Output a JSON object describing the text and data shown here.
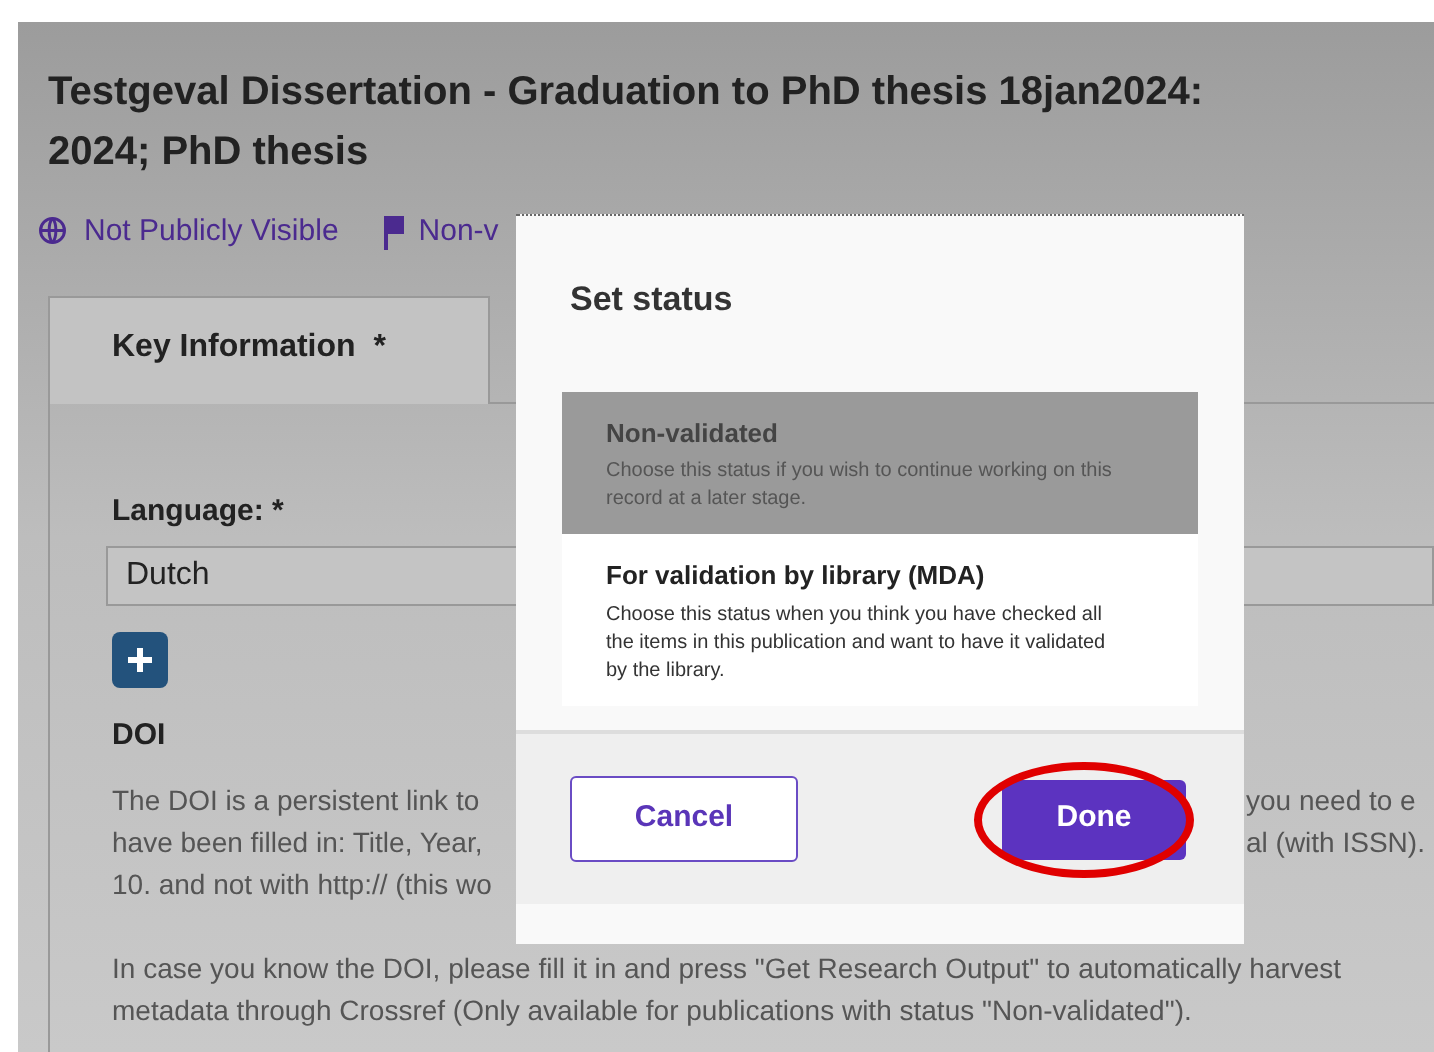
{
  "title_lines": [
    "Testgeval Dissertation - Graduation to PhD thesis 18jan2024:",
    "2024; PhD thesis"
  ],
  "status_links": [
    {
      "kind": "globe",
      "label": "Not Publicly Visible"
    },
    {
      "kind": "flag",
      "label": "Non-v"
    }
  ],
  "tab": {
    "label": "Key Information",
    "required_mark": "*"
  },
  "language": {
    "label": "Language: *",
    "value": "Dutch"
  },
  "doi": {
    "heading": "DOI",
    "visible_lines": [
      {
        "left": "The DOI is a persistent link to",
        "right": "you need to e"
      },
      {
        "left": "have been filled in: Title, Year,",
        "right": "al (with ISSN)."
      },
      {
        "left": "10. and not with http:// (this wo"
      }
    ],
    "paragraph_2": "In case you know the DOI, please fill it in and press \"Get Research Output\" to automatically harvest",
    "paragraph_2_line_2": "metadata through Crossref (Only available for publications with status \"Non-validated\")."
  },
  "dialog": {
    "title": "Set status",
    "options": [
      {
        "label": "Non-validated",
        "description": "Choose this status if you wish to continue working on this record at a later stage.",
        "selected": true
      },
      {
        "label": "For validation by library (MDA)",
        "description": "Choose this status when you think you have checked all the items in this publication and want to have it validated by the library.",
        "selected": false
      }
    ],
    "cancel": "Cancel",
    "done": "Done",
    "done_highlighted": true
  }
}
